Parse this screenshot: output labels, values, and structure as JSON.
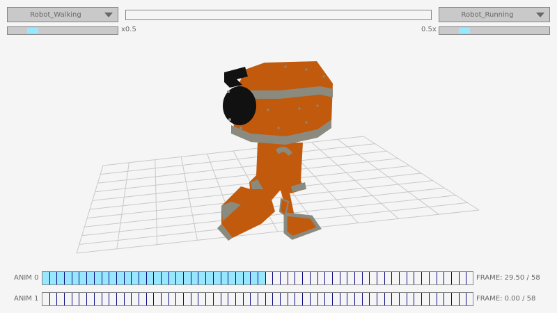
{
  "left_dropdown": {
    "value": "Robot_Walking"
  },
  "right_dropdown": {
    "value": "Robot_Running"
  },
  "left_speed": {
    "label": "x0.5",
    "value": 0.5
  },
  "right_speed": {
    "label": "0.5x",
    "value": 0.5
  },
  "timelines": [
    {
      "label": "ANIM 0",
      "frame_text": "FRAME: 29.50 / 58",
      "frame": 29.5,
      "total": 58
    },
    {
      "label": "ANIM 1",
      "frame_text": "FRAME: 0.00 / 58",
      "frame": 0.0,
      "total": 58
    }
  ],
  "colors": {
    "accent": "#97e8ff",
    "timeline_line": "#0a0a82",
    "robot_body": "#c25a0e",
    "robot_trim": "#8a8a7e",
    "robot_eye": "#111111",
    "grid": "#c8c8c8"
  },
  "icons": {
    "dropdown_arrow": "caret-down-icon"
  }
}
